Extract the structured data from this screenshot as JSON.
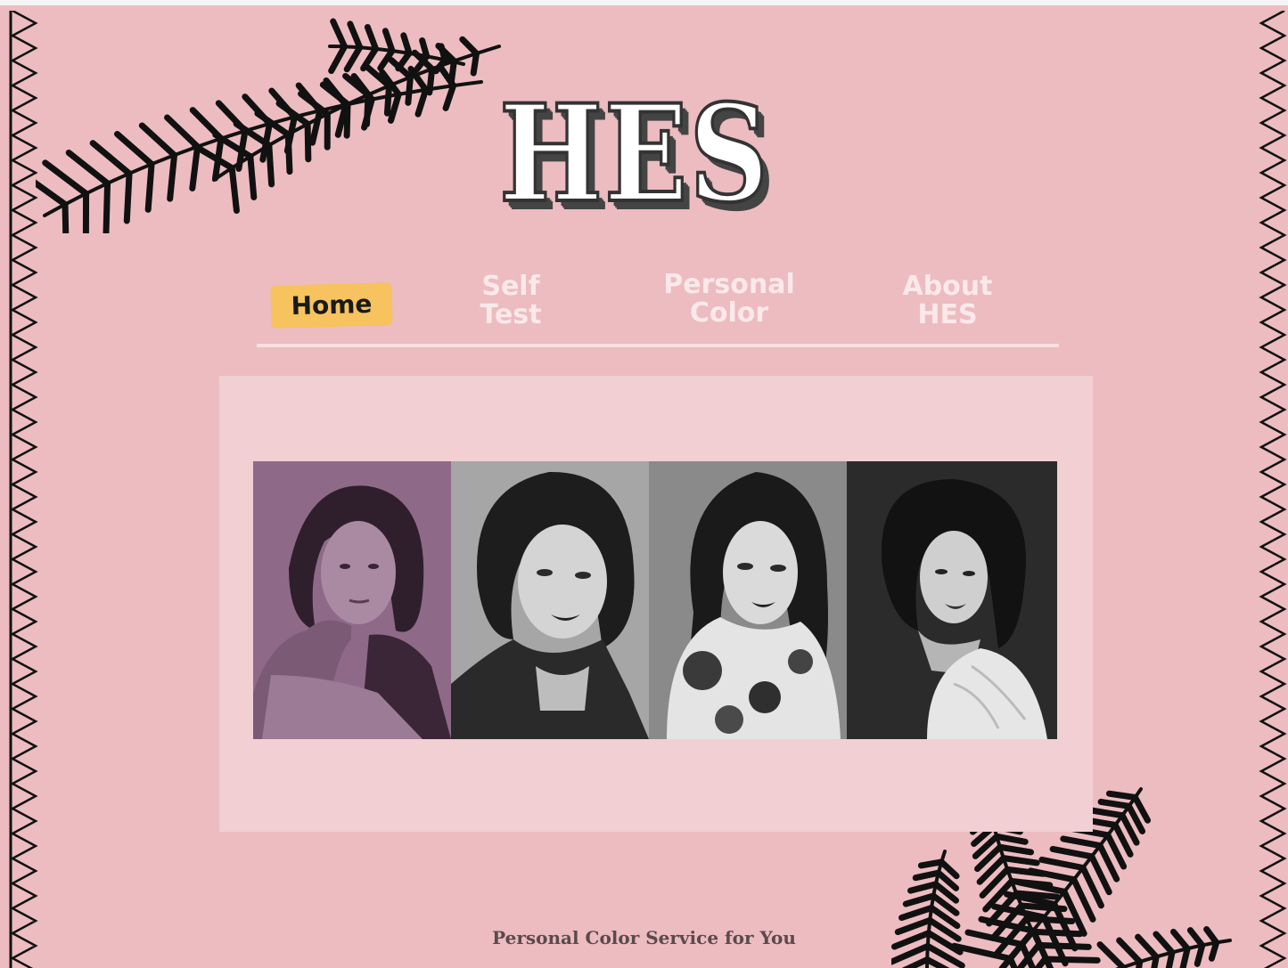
{
  "logo": {
    "text": "HES"
  },
  "nav": {
    "items": [
      {
        "label": "Home",
        "active": true
      },
      {
        "label": "Self\nTest",
        "active": false
      },
      {
        "label": "Personal\nColor",
        "active": false
      },
      {
        "label": "About\nHES",
        "active": false
      }
    ]
  },
  "gallery": {
    "photos": [
      {
        "icon": "portrait-photo",
        "tint": "#8e6a88"
      },
      {
        "icon": "portrait-photo",
        "tint": "#9a9a9a"
      },
      {
        "icon": "portrait-photo",
        "tint": "#8a8a8a"
      },
      {
        "icon": "portrait-photo",
        "tint": "#2b2b2b"
      }
    ]
  },
  "footer": {
    "tagline": "Personal Color Service for You"
  },
  "colors": {
    "background": "#ecbcc0",
    "panel": "#f1cfd3",
    "nav_active": "#f6c35e",
    "nav_text": "#fbe8ea"
  }
}
